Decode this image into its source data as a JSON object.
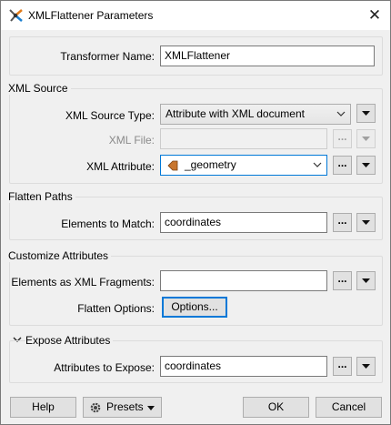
{
  "window": {
    "title": "XMLFlattener Parameters"
  },
  "transformer": {
    "label": "Transformer Name:",
    "value": "XMLFlattener"
  },
  "xml_source": {
    "title": "XML Source",
    "source_type_label": "XML Source Type:",
    "source_type_value": "Attribute with XML document",
    "xml_file_label": "XML File:",
    "xml_file_value": "",
    "xml_attribute_label": "XML Attribute:",
    "xml_attribute_value": "_geometry"
  },
  "flatten_paths": {
    "title": "Flatten Paths",
    "elements_label": "Elements to Match:",
    "elements_value": "coordinates"
  },
  "customize": {
    "title": "Customize Attributes",
    "fragments_label": "Elements as XML Fragments:",
    "fragments_value": "",
    "options_label": "Flatten Options:",
    "options_button": "Options..."
  },
  "expose": {
    "title": "Expose Attributes",
    "attrs_label": "Attributes to Expose:",
    "attrs_value": "coordinates"
  },
  "footer": {
    "help": "Help",
    "presets": "Presets",
    "ok": "OK",
    "cancel": "Cancel"
  },
  "ellipsis": "...",
  "colors": {
    "accent": "#0078d7",
    "attribute_icon": "#c8752d"
  }
}
